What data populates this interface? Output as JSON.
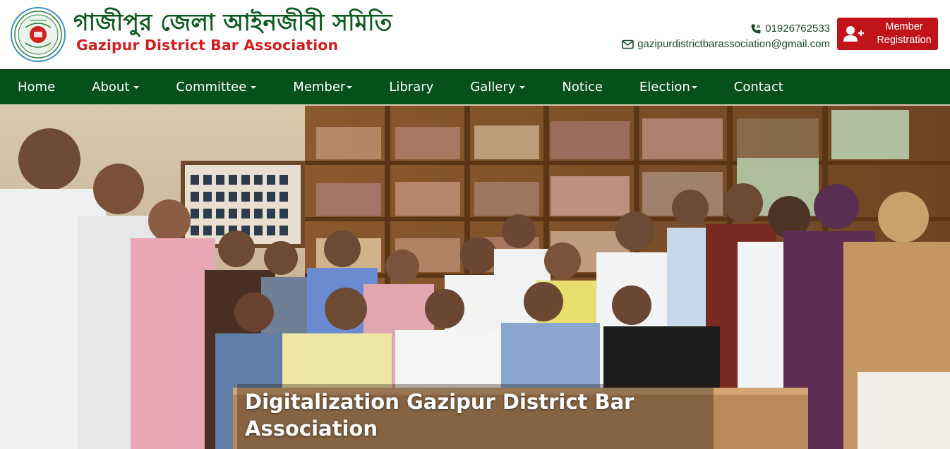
{
  "header": {
    "logo_icon": "bar-association-seal-icon",
    "title_bn": "গাজীপুর জেলা আইনজীবী সমিতি",
    "title_en": "Gazipur District Bar Association",
    "phone": "01926762533",
    "email": "gazipurdistrictbarassociation@gmail.com",
    "phone_icon": "phone-icon",
    "email_icon": "envelope-icon",
    "register_icon": "user-plus-icon",
    "register_label_line1": "Member",
    "register_label_line2": "Registration"
  },
  "nav": {
    "items": [
      {
        "label": "Home",
        "dropdown": false
      },
      {
        "label": "About",
        "dropdown": true
      },
      {
        "label": "Committee",
        "dropdown": true
      },
      {
        "label": "Member",
        "dropdown": true
      },
      {
        "label": "Library",
        "dropdown": false
      },
      {
        "label": "Gallery",
        "dropdown": true
      },
      {
        "label": "Notice",
        "dropdown": false
      },
      {
        "label": "Election",
        "dropdown": true
      },
      {
        "label": "Contact",
        "dropdown": false
      }
    ]
  },
  "hero": {
    "caption": "Digitalization Gazipur District Bar Association"
  },
  "colors": {
    "brand_green": "#06501c",
    "title_green": "#0b5a1e",
    "title_red": "#d11f1f",
    "button_red": "#c0141a"
  }
}
